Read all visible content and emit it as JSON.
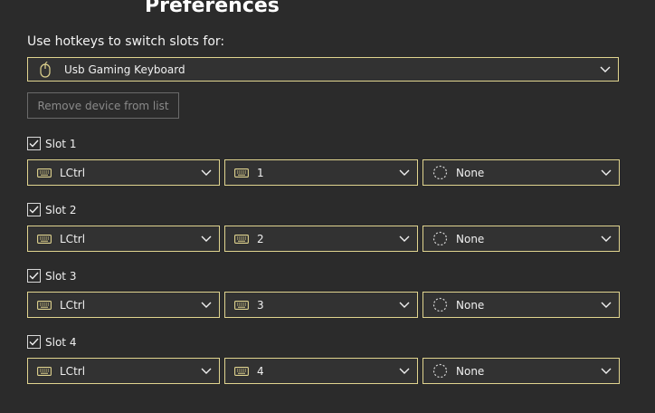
{
  "header": {
    "title": "Preferences",
    "subtitle": "Use hotkeys to switch slots for:"
  },
  "device": {
    "icon": "mouse-icon",
    "selected": "Usb Gaming Keyboard"
  },
  "remove_button": {
    "label": "Remove device from list"
  },
  "colors": {
    "accent_border": "#e0d48f",
    "background": "#2b2b2b",
    "control_bg": "#323232"
  },
  "slots": [
    {
      "label": "Slot 1",
      "checked": true,
      "modifier": "LCtrl",
      "key": "1",
      "extra": "None"
    },
    {
      "label": "Slot 2",
      "checked": true,
      "modifier": "LCtrl",
      "key": "2",
      "extra": "None"
    },
    {
      "label": "Slot 3",
      "checked": true,
      "modifier": "LCtrl",
      "key": "3",
      "extra": "None"
    },
    {
      "label": "Slot 4",
      "checked": true,
      "modifier": "LCtrl",
      "key": "4",
      "extra": "None"
    }
  ]
}
